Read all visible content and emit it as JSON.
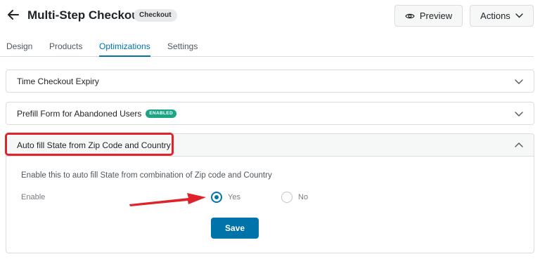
{
  "header": {
    "title": "Multi-Step Checkout",
    "badge": "Checkout",
    "preview_label": "Preview",
    "actions_label": "Actions"
  },
  "tabs": [
    {
      "label": "Design",
      "active": false
    },
    {
      "label": "Products",
      "active": false
    },
    {
      "label": "Optimizations",
      "active": true
    },
    {
      "label": "Settings",
      "active": false
    }
  ],
  "panels": [
    {
      "title": "Time Checkout Expiry",
      "expanded": false
    },
    {
      "title": "Prefill Form for Abandoned Users",
      "badge": "ENABLED",
      "expanded": false
    },
    {
      "title": "Auto fill State from Zip Code and Country",
      "expanded": true,
      "description": "Enable this to auto fill State from combination of Zip code and Country",
      "field_label": "Enable",
      "options": [
        {
          "label": "Yes",
          "selected": true
        },
        {
          "label": "No",
          "selected": false
        }
      ],
      "save_label": "Save"
    }
  ],
  "colors": {
    "accent": "#0073aa",
    "enabled_badge": "#1aa584",
    "annotation": "#e0232a"
  },
  "icons": [
    "back-arrow-icon",
    "eye-icon",
    "chevron-down-icon",
    "chevron-up-icon"
  ]
}
